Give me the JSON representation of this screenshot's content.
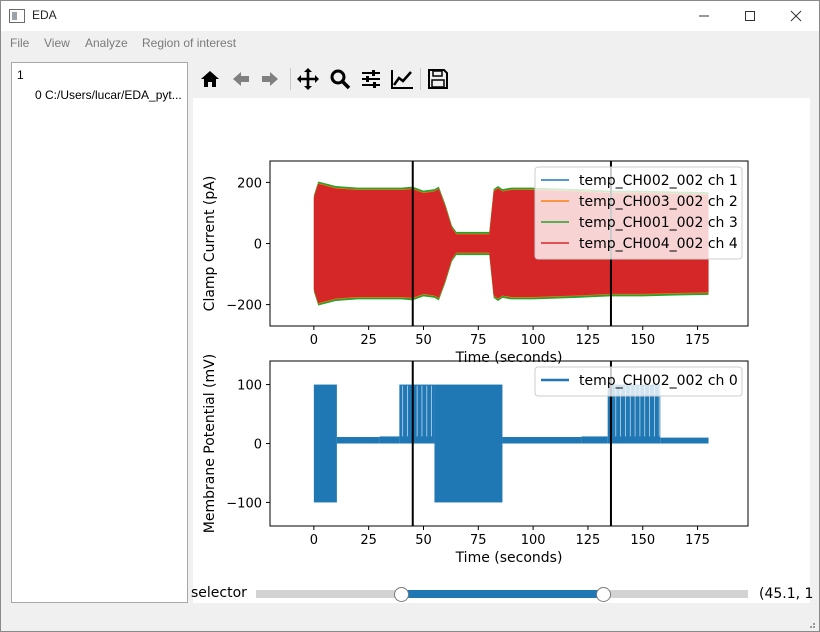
{
  "window": {
    "title": "EDA",
    "icons": [
      "minimize-icon",
      "maximize-icon",
      "close-icon"
    ]
  },
  "menu": [
    "File",
    "View",
    "Analyze",
    "Region of interest"
  ],
  "tree": {
    "root": "1",
    "child": "0 C:/Users/lucar/EDA_pyt..."
  },
  "toolbar": [
    "home-icon",
    "back-icon",
    "forward-icon",
    "pan-icon",
    "zoom-icon",
    "configure-subplots-icon",
    "edit-axis-icon",
    "save-icon"
  ],
  "slider": {
    "label": "selector",
    "value": "(45.1, 1",
    "range": [
      45.1,
      135.5
    ],
    "min": -20,
    "max": 200
  },
  "chart_data": [
    {
      "type": "line",
      "xlabel": "Time (seconds)",
      "ylabel": "Clamp Current (pA)",
      "xlim": [
        -20,
        198
      ],
      "ylim": [
        -270,
        270
      ],
      "xticks": [
        0,
        25,
        50,
        75,
        100,
        125,
        150,
        175
      ],
      "yticks": [
        -200,
        0,
        200
      ],
      "ytick_labels": [
        "−200",
        "0",
        "200"
      ],
      "vlines": [
        45.1,
        135.5
      ],
      "legend": "top-right",
      "series": [
        {
          "name": "temp_CH002_002 ch 1",
          "color": "#1f77b4"
        },
        {
          "name": "temp_CH003_002 ch 2",
          "color": "#ff7f0e"
        },
        {
          "name": "temp_CH001_002 ch 3",
          "color": "#2ca02c"
        },
        {
          "name": "temp_CH004_002 ch 4",
          "color": "#d62728"
        }
      ],
      "envelope": {
        "x": [
          0,
          2,
          10,
          20,
          30,
          40,
          45,
          50,
          55,
          57,
          60,
          63,
          65,
          70,
          75,
          80,
          81,
          82,
          84,
          86,
          90,
          100,
          120,
          135,
          150,
          165,
          180
        ],
        "upper": [
          150,
          195,
          180,
          175,
          175,
          175,
          178,
          165,
          170,
          178,
          120,
          50,
          30,
          30,
          30,
          30,
          100,
          170,
          180,
          170,
          175,
          175,
          170,
          165,
          165,
          162,
          160
        ],
        "lower": [
          -150,
          -195,
          -180,
          -175,
          -175,
          -175,
          -178,
          -165,
          -170,
          -178,
          -120,
          -50,
          -30,
          -30,
          -30,
          -30,
          -100,
          -170,
          -180,
          -170,
          -175,
          -175,
          -170,
          -165,
          -165,
          -162,
          -160
        ]
      }
    },
    {
      "type": "line",
      "xlabel": "Time (seconds)",
      "ylabel": "Membrane Potential (mV)",
      "xlim": [
        -20,
        198
      ],
      "ylim": [
        -140,
        140
      ],
      "xticks": [
        0,
        25,
        50,
        75,
        100,
        125,
        150,
        175
      ],
      "yticks": [
        -100,
        0,
        100
      ],
      "ytick_labels": [
        "−100",
        "0",
        "100"
      ],
      "vlines": [
        45.1,
        135.5
      ],
      "legend": "top-right",
      "series": [
        {
          "name": "temp_CH002_002 ch 0",
          "color": "#1f77b4"
        }
      ],
      "blocks": [
        {
          "x0": 0,
          "x1": 10.5,
          "lo": -100,
          "hi": 100
        },
        {
          "x0": 10.5,
          "x1": 30,
          "lo": 0,
          "hi": 11
        },
        {
          "x0": 30,
          "x1": 39,
          "lo": 0,
          "hi": 12
        },
        {
          "x0": 39,
          "x1": 55,
          "lo": 0,
          "hi": 100
        },
        {
          "x0": 55,
          "x1": 86,
          "lo": -100,
          "hi": 100
        },
        {
          "x0": 86,
          "x1": 122,
          "lo": 0,
          "hi": 11
        },
        {
          "x0": 122,
          "x1": 134,
          "lo": 0,
          "hi": 12
        },
        {
          "x0": 134,
          "x1": 158,
          "lo": 0,
          "hi": 100
        },
        {
          "x0": 158,
          "x1": 180,
          "lo": 0,
          "hi": 10
        }
      ]
    }
  ]
}
